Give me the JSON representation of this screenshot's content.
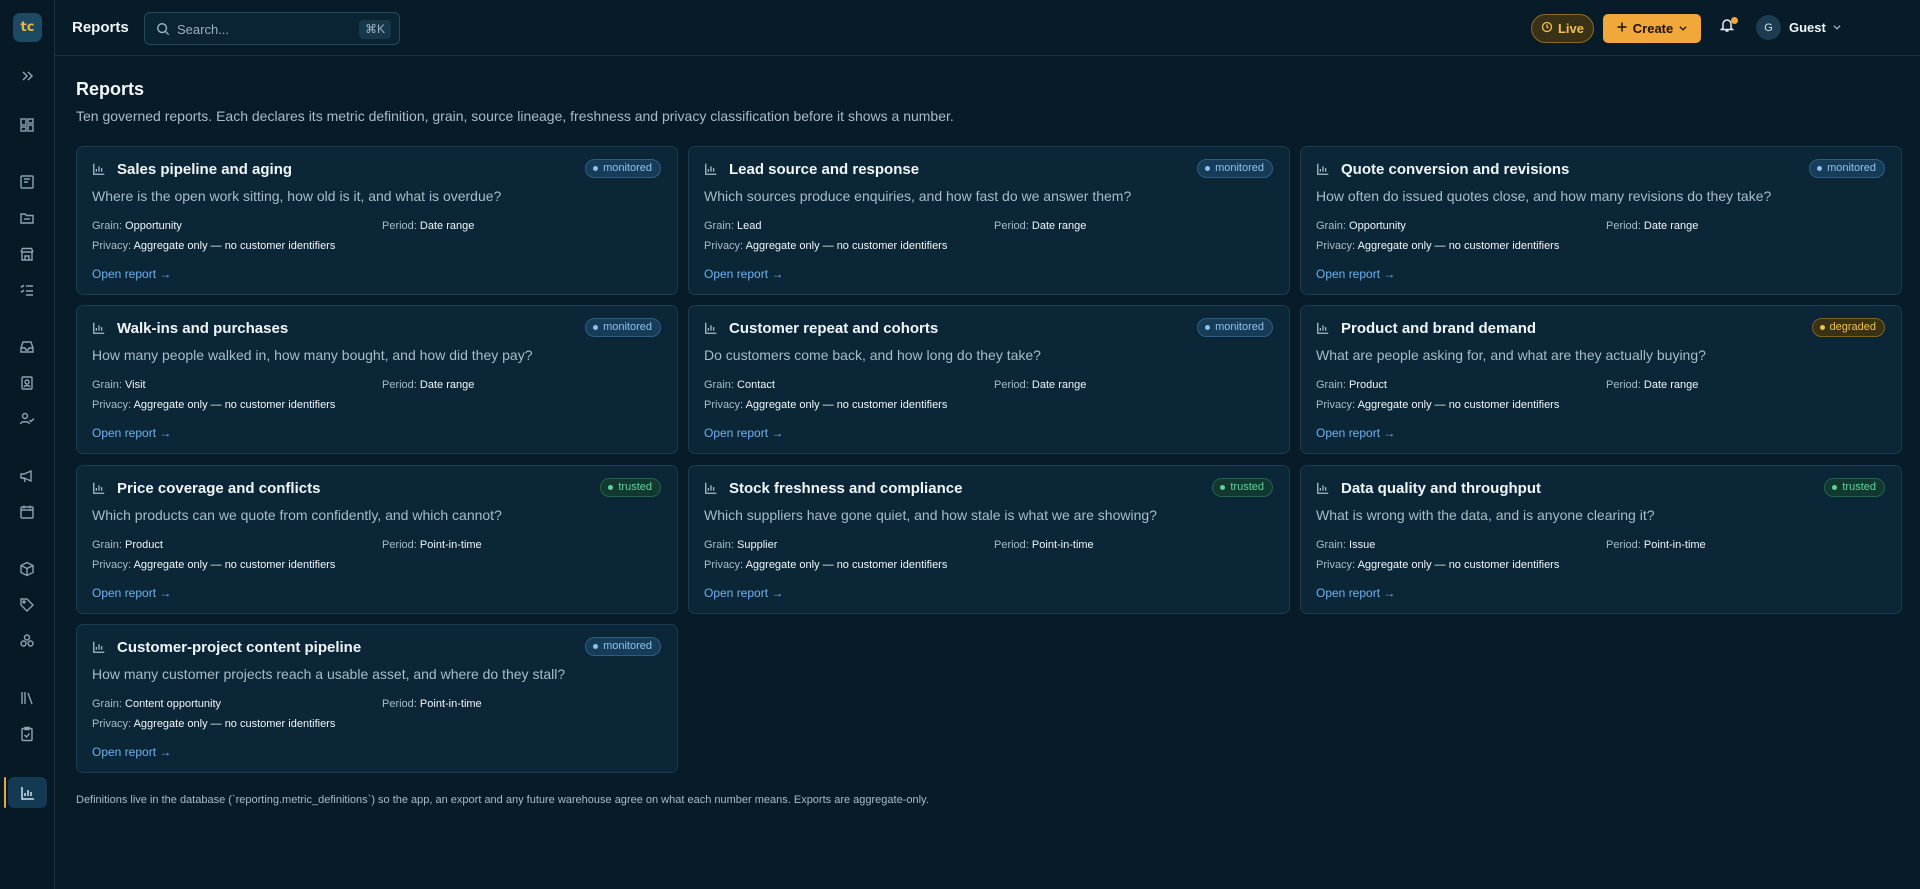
{
  "app": {
    "logo_text": "tc"
  },
  "header": {
    "title": "Reports",
    "search_placeholder": "Search...",
    "search_shortcut": "⌘K",
    "live_label": "Live",
    "create_label": "Create",
    "user_initial": "G",
    "user_name": "Guest"
  },
  "sidebar": {
    "items": [
      {
        "icon": "chevrons-right-icon"
      },
      {
        "icon": "dashboard-icon"
      },
      {
        "icon": "board-icon"
      },
      {
        "icon": "folder-icon"
      },
      {
        "icon": "store-icon"
      },
      {
        "icon": "checklist-icon"
      },
      {
        "icon": "inbox-icon"
      },
      {
        "icon": "contact-card-icon"
      },
      {
        "icon": "user-check-icon"
      },
      {
        "icon": "megaphone-icon"
      },
      {
        "icon": "calendar-icon"
      },
      {
        "icon": "package-icon"
      },
      {
        "icon": "tag-icon"
      },
      {
        "icon": "cluster-icon"
      },
      {
        "icon": "library-icon"
      },
      {
        "icon": "clipboard-check-icon"
      },
      {
        "icon": "bar-chart-icon",
        "active": true
      }
    ]
  },
  "page": {
    "title": "Reports",
    "subtitle": "Ten governed reports. Each declares its metric definition, grain, source lineage, freshness and privacy classification before it shows a number.",
    "footnote": "Definitions live in the database (`reporting.metric_definitions`) so the app, an export and any future warehouse agree on what each number means. Exports are aggregate-only."
  },
  "labels": {
    "grain": "Grain:",
    "period": "Period:",
    "privacy": "Privacy:",
    "open_report": "Open report →"
  },
  "colors": {
    "monitored": "#8ec1f0",
    "trusted": "#5fd39a",
    "degraded": "#f0c14e",
    "accent": "#f1a73a"
  },
  "reports": [
    {
      "title": "Sales pipeline and aging",
      "status": "monitored",
      "question": "Where is the open work sitting, how old is it, and what is overdue?",
      "grain": "Opportunity",
      "period": "Date range",
      "privacy": "Aggregate only — no customer identifiers"
    },
    {
      "title": "Lead source and response",
      "status": "monitored",
      "question": "Which sources produce enquiries, and how fast do we answer them?",
      "grain": "Lead",
      "period": "Date range",
      "privacy": "Aggregate only — no customer identifiers"
    },
    {
      "title": "Quote conversion and revisions",
      "status": "monitored",
      "question": "How often do issued quotes close, and how many revisions do they take?",
      "grain": "Opportunity",
      "period": "Date range",
      "privacy": "Aggregate only — no customer identifiers"
    },
    {
      "title": "Walk-ins and purchases",
      "status": "monitored",
      "question": "How many people walked in, how many bought, and how did they pay?",
      "grain": "Visit",
      "period": "Date range",
      "privacy": "Aggregate only — no customer identifiers"
    },
    {
      "title": "Customer repeat and cohorts",
      "status": "monitored",
      "question": "Do customers come back, and how long do they take?",
      "grain": "Contact",
      "period": "Date range",
      "privacy": "Aggregate only — no customer identifiers"
    },
    {
      "title": "Product and brand demand",
      "status": "degraded",
      "question": "What are people asking for, and what are they actually buying?",
      "grain": "Product",
      "period": "Date range",
      "privacy": "Aggregate only — no customer identifiers"
    },
    {
      "title": "Price coverage and conflicts",
      "status": "trusted",
      "question": "Which products can we quote from confidently, and which cannot?",
      "grain": "Product",
      "period": "Point-in-time",
      "privacy": "Aggregate only — no customer identifiers"
    },
    {
      "title": "Stock freshness and compliance",
      "status": "trusted",
      "question": "Which suppliers have gone quiet, and how stale is what we are showing?",
      "grain": "Supplier",
      "period": "Point-in-time",
      "privacy": "Aggregate only — no customer identifiers"
    },
    {
      "title": "Data quality and throughput",
      "status": "trusted",
      "question": "What is wrong with the data, and is anyone clearing it?",
      "grain": "Issue",
      "period": "Point-in-time",
      "privacy": "Aggregate only — no customer identifiers"
    },
    {
      "title": "Customer-project content pipeline",
      "status": "monitored",
      "question": "How many customer projects reach a usable asset, and where do they stall?",
      "grain": "Content opportunity",
      "period": "Point-in-time",
      "privacy": "Aggregate only — no customer identifiers"
    }
  ]
}
